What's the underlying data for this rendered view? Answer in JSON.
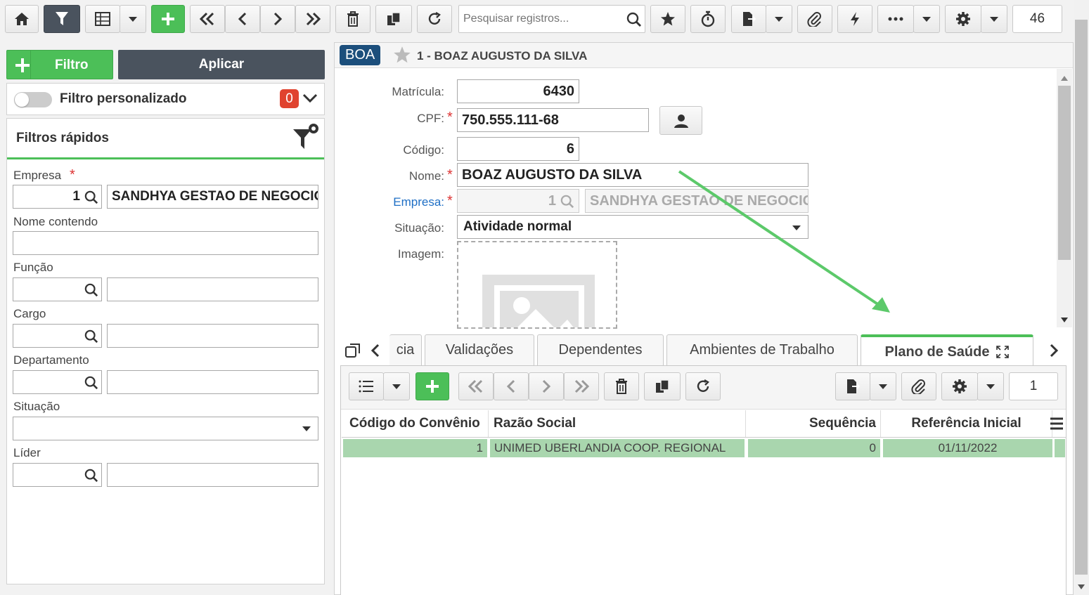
{
  "toolbar": {
    "search_placeholder": "Pesquisar registros...",
    "record_count": "46"
  },
  "filters": {
    "add_label": "Filtro",
    "apply_label": "Aplicar",
    "custom_filter_label": "Filtro personalizado",
    "custom_filter_count": "0",
    "quick_filters_title": "Filtros rápidos",
    "empresa_label": "Empresa",
    "empresa_code": "1",
    "empresa_name": "SANDHYA GESTAO DE NEGOCIOS",
    "nome_label": "Nome contendo",
    "funcao_label": "Função",
    "cargo_label": "Cargo",
    "departamento_label": "Departamento",
    "situacao_label": "Situação",
    "lider_label": "Líder"
  },
  "record": {
    "badge": "BOA",
    "title": "1 - BOAZ AUGUSTO DA SILVA"
  },
  "form": {
    "matricula_label": "Matrícula:",
    "matricula_value": "6430",
    "cpf_label": "CPF:",
    "cpf_value": "750.555.111-68",
    "codigo_label": "Código:",
    "codigo_value": "6",
    "nome_label": "Nome:",
    "nome_value": "BOAZ AUGUSTO DA SILVA",
    "empresa_label": "Empresa:",
    "empresa_code": "1",
    "empresa_name": "SANDHYA GESTAO DE NEGOCIOS",
    "situacao_label": "Situação:",
    "situacao_value": "Atividade normal",
    "imagem_label": "Imagem:"
  },
  "tabs": {
    "partial": "cia",
    "validacoes": "Validações",
    "dependentes": "Dependentes",
    "ambientes": "Ambientes de Trabalho",
    "plano": "Plano de Saúde"
  },
  "subgrid": {
    "record_count": "1",
    "columns": [
      "Código do Convênio",
      "Razão Social",
      "Sequência",
      "Referência Inicial"
    ],
    "rows": [
      {
        "codigo": "1",
        "razao": "UNIMED UBERLANDIA COOP. REGIONAL",
        "sequencia": "0",
        "referencia": "01/11/2022"
      }
    ]
  },
  "colors": {
    "green": "#4cbf58",
    "dark": "#4a535e",
    "badge": "#1c4f7c",
    "arrow": "#5cc96a",
    "row_selected": "#a9d6ae"
  }
}
